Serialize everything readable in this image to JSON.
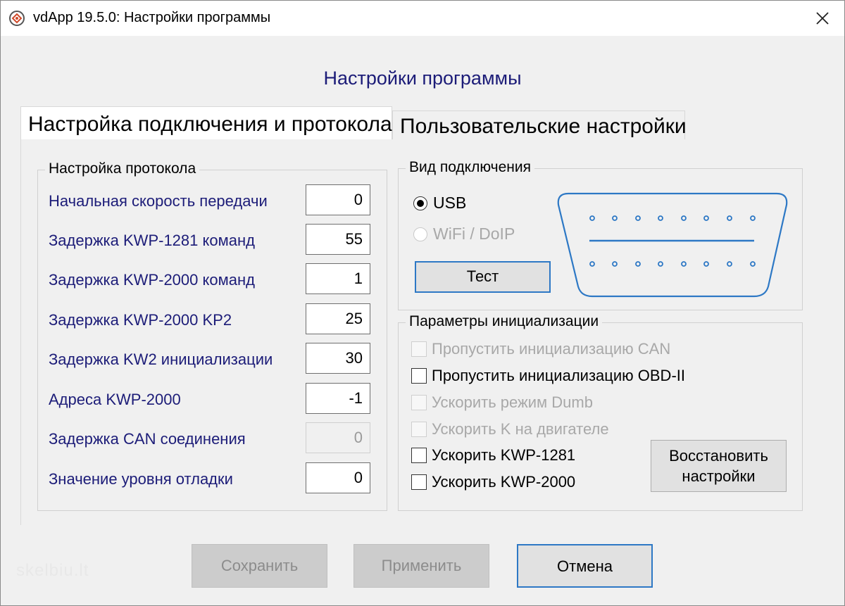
{
  "window": {
    "title": "vdApp 19.5.0:  Настройки программы"
  },
  "header": {
    "title": "Настройки программы"
  },
  "tabs": [
    {
      "label": "Настройка подключения и протокола",
      "active": true
    },
    {
      "label": "Пользовательские настройки",
      "active": false
    }
  ],
  "protocol": {
    "title": "Настройка протокола",
    "rows": [
      {
        "label": "Начальная скорость передачи",
        "value": "0"
      },
      {
        "label": "Задержка KWP-1281 команд",
        "value": "55"
      },
      {
        "label": "Задержка KWP-2000 команд",
        "value": "1"
      },
      {
        "label": "Задержка KWP-2000 KP2",
        "value": "25"
      },
      {
        "label": "Задержка KW2 инициализации",
        "value": "30"
      },
      {
        "label": "Адреса KWP-2000",
        "value": "-1"
      },
      {
        "label": "Задержка CAN соединения",
        "value": "0",
        "disabled": true
      },
      {
        "label": "Значение уровня отладки",
        "value": "0"
      }
    ]
  },
  "connection": {
    "title": "Вид подключения",
    "options": [
      {
        "label": "USB",
        "checked": true,
        "disabled": false
      },
      {
        "label": "WiFi / DoIP",
        "checked": false,
        "disabled": true
      }
    ],
    "test_label": "Тест",
    "connector_icon": "obd-connector-icon"
  },
  "init": {
    "title": "Параметры инициализации",
    "items": [
      {
        "label": "Пропустить инициализацию CAN",
        "checked": false,
        "disabled": true
      },
      {
        "label": "Пропустить инициализацию OBD-II",
        "checked": false,
        "disabled": false
      },
      {
        "label": "Ускорить режим Dumb",
        "checked": false,
        "disabled": true
      },
      {
        "label": "Ускорить K на двигателе",
        "checked": false,
        "disabled": true
      },
      {
        "label": "Ускорить KWP-1281",
        "checked": false,
        "disabled": false
      },
      {
        "label": "Ускорить KWP-2000",
        "checked": false,
        "disabled": false
      }
    ],
    "restore_label_line1": "Восстановить",
    "restore_label_line2": "настройки"
  },
  "footer": {
    "save_label": "Сохранить",
    "apply_label": "Применить",
    "cancel_label": "Отмена"
  },
  "watermark": "skelbiu.lt",
  "colors": {
    "accent": "#2d78c5",
    "label": "#1c1c78"
  }
}
